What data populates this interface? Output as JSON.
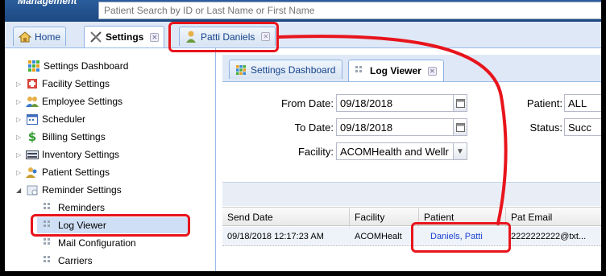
{
  "header": {
    "brand": "Management",
    "search_placeholder": "Patient Search by ID or Last Name or First Name"
  },
  "tabs": [
    {
      "label": "Home",
      "icon": "home-icon"
    },
    {
      "label": "Settings",
      "icon": "tools-icon"
    },
    {
      "label": "Patti Daniels",
      "icon": "person-icon"
    }
  ],
  "sidebar": {
    "items": [
      {
        "label": "Settings Dashboard",
        "icon": "dashboard-grid-icon"
      },
      {
        "label": "Facility Settings",
        "icon": "facility-icon"
      },
      {
        "label": "Employee Settings",
        "icon": "employees-icon"
      },
      {
        "label": "Scheduler",
        "icon": "calendar-icon"
      },
      {
        "label": "Billing Settings",
        "icon": "dollar-icon"
      },
      {
        "label": "Inventory Settings",
        "icon": "inventory-icon"
      },
      {
        "label": "Patient Settings",
        "icon": "patients-icon"
      },
      {
        "label": "Reminder Settings",
        "icon": "reminder-icon"
      },
      {
        "label": "Reminders",
        "icon": "grid-icon"
      },
      {
        "label": "Log Viewer",
        "icon": "grid-icon"
      },
      {
        "label": "Mail Configuration",
        "icon": "grid-icon"
      },
      {
        "label": "Carriers",
        "icon": "grid-icon"
      }
    ]
  },
  "content": {
    "tabs": [
      {
        "label": "Settings Dashboard"
      },
      {
        "label": "Log Viewer"
      }
    ],
    "form": {
      "from_date_label": "From Date:",
      "from_date_value": "09/18/2018",
      "to_date_label": "To Date:",
      "to_date_value": "09/18/2018",
      "facility_label": "Facility:",
      "facility_value": "ACOMHealth and Wellr",
      "patient_label": "Patient:",
      "patient_value": "ALL",
      "status_label": "Status:",
      "status_value": "Succ"
    },
    "grid": {
      "columns": [
        "Send Date",
        "Facility",
        "Patient",
        "Pat Email"
      ],
      "rows": [
        {
          "send_date": "09/18/2018 12:17:23 AM",
          "facility": "ACOMHealt",
          "patient": "Daniels, Patti",
          "pat_email": "2222222222@txt..."
        }
      ]
    }
  },
  "colors": {
    "annotation_red": "#e8141c",
    "header_blue": "#1d4880",
    "link_blue": "#1a3fd1"
  }
}
